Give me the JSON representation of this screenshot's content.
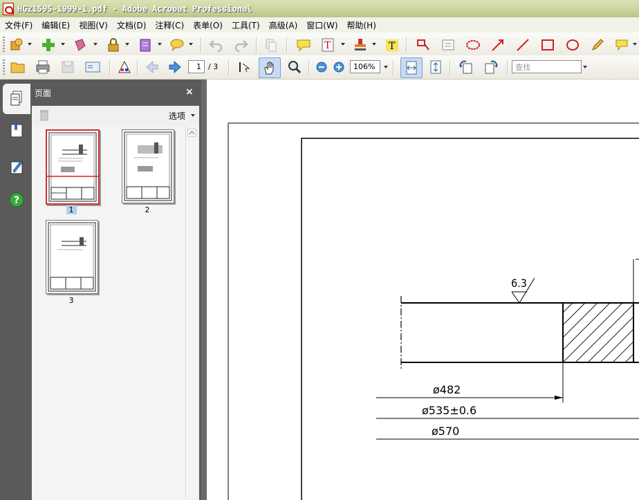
{
  "window": {
    "title": "HG21595-1999-1.pdf - Adobe Acrobat Professional"
  },
  "menu": [
    "文件(F)",
    "编辑(E)",
    "视图(V)",
    "文档(D)",
    "注释(C)",
    "表单(O)",
    "工具(T)",
    "高级(A)",
    "窗口(W)",
    "帮助(H)"
  ],
  "toolbar": {
    "current_page": "1",
    "page_total": "/ 3",
    "zoom": "106%",
    "search_placeholder": "查找"
  },
  "sidebar": {
    "panel_title": "页面",
    "close_glyph": "×",
    "options_label": "选项",
    "thumbnails": [
      {
        "label": "1",
        "selected": true
      },
      {
        "label": "2",
        "selected": false
      },
      {
        "label": "3",
        "selected": false
      }
    ]
  },
  "drawing": {
    "roughness": "6.3",
    "dim_inner": "ø482",
    "dim_mid": "ø535±0.6",
    "dim_outer": "ø570"
  },
  "colors": {
    "accent_red": "#cc2222",
    "selection_blue": "#b6cfe8",
    "help_green": "#3aa83a"
  }
}
